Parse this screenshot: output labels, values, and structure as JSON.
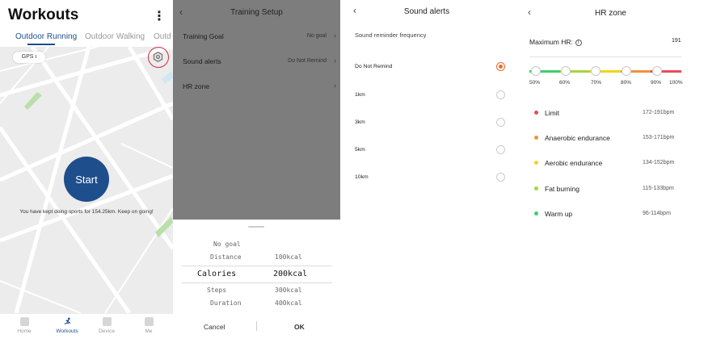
{
  "workouts": {
    "title": "Workouts",
    "more_glyph": "⋮",
    "tabs": [
      "Outdoor Running",
      "Outdoor Walking",
      "Outd"
    ],
    "gps_label": "GPS",
    "start_label": "Start",
    "total_text": "You have kept doing sports for 154.25km. Keep on going!",
    "nav": [
      "Home",
      "Workouts",
      "Device",
      "Me"
    ],
    "settings_icon": "gear-icon",
    "accent_color": "#1f4e8c",
    "highlight_color": "#d0304a"
  },
  "training_setup": {
    "back_glyph": "‹",
    "title": "Training Setup",
    "rows": [
      {
        "label": "Training Goal",
        "value": "No goal"
      },
      {
        "label": "Sound alerts",
        "value": "Do Not Remind"
      },
      {
        "label": "HR zone",
        "value": ""
      }
    ],
    "picker_left": [
      "No goal",
      "Distance",
      "Calories",
      "Steps",
      "Duration"
    ],
    "picker_right": [
      "100kcal",
      "200kcal",
      "300kcal",
      "400kcal"
    ],
    "picker_selected": "Calories",
    "picker_selected_value": "200kcal",
    "cancel_label": "Cancel",
    "ok_label": "OK"
  },
  "sound_alerts": {
    "back_glyph": "‹",
    "title": "Sound alerts",
    "subtitle": "Sound reminder frequency",
    "options": [
      "Do Not Remind",
      "1km",
      "3km",
      "5km",
      "10km"
    ],
    "selected": "Do Not Remind",
    "selected_color": "#f06a2b"
  },
  "hr_zone": {
    "back_glyph": "‹",
    "title": "HR zone",
    "max_label": "Maximum HR:",
    "max_value": "191",
    "percent_marks": [
      "50%",
      "60%",
      "70%",
      "80%",
      "90%",
      "100%"
    ],
    "zone_colors": [
      "#3ecf6e",
      "#a6d63a",
      "#f3d41c",
      "#f1913b",
      "#ea4a5a"
    ],
    "zones": [
      {
        "name": "Limit",
        "range": "172-191bpm",
        "color": "#ea4a5a"
      },
      {
        "name": "Anaerobic endurance",
        "range": "153-171bpm",
        "color": "#f1913b"
      },
      {
        "name": "Aerobic endurance",
        "range": "134-152bpm",
        "color": "#f3d41c"
      },
      {
        "name": "Fat burning",
        "range": "115-133bpm",
        "color": "#a6d63a"
      },
      {
        "name": "Warm up",
        "range": "96-114bpm",
        "color": "#3ecf6e"
      }
    ]
  }
}
